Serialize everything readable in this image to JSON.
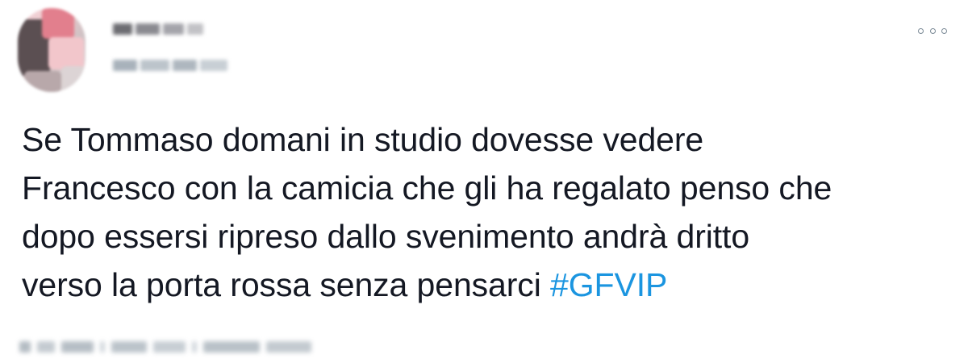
{
  "tweet": {
    "author": {
      "avatar_icon": "user-avatar-blurred",
      "name_redacted": true,
      "handle_redacted": true
    },
    "more_icon": "more-options-icon",
    "text_lines": [
      "Se Tommaso domani in studio dovesse vedere",
      "Francesco con la camicia che gli ha regalato penso che",
      "dopo essersi ripreso dallo svenimento andrà dritto",
      "verso la porta rossa senza pensarci "
    ],
    "hashtag": "#GFVIP",
    "meta_redacted": true
  },
  "colors": {
    "text": "#141823",
    "hashtag": "#1b95e0",
    "icon": "#7b8a96",
    "background": "#ffffff"
  }
}
